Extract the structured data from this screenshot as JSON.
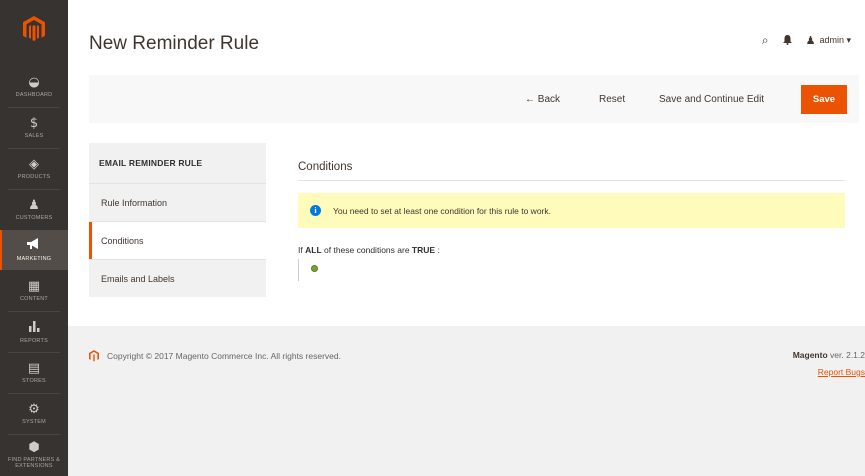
{
  "sidebar": {
    "items": [
      {
        "icon": "◒",
        "label": "Dashboard"
      },
      {
        "icon": "$",
        "label": "Sales"
      },
      {
        "icon": "◈",
        "label": "Products"
      },
      {
        "icon": "♟",
        "label": "Customers"
      },
      {
        "icon": "📣",
        "label": "Marketing"
      },
      {
        "icon": "▦",
        "label": "Content"
      },
      {
        "icon": "▮",
        "label": "Reports"
      },
      {
        "icon": "▤",
        "label": "Stores"
      },
      {
        "icon": "⚙",
        "label": "System"
      },
      {
        "icon": "⬢",
        "label": "Find Partners & Extensions"
      }
    ],
    "active_item": "Marketing"
  },
  "header": {
    "title": "New Reminder Rule",
    "search_icon": "⌕",
    "bell_icon": "♪",
    "user_icon": "♟",
    "user_name": "admin ▾"
  },
  "action_bar": {
    "back": "← Back",
    "reset": "Reset",
    "save_continue": "Save and Continue Edit",
    "save": "Save"
  },
  "tabs": {
    "title": "EMAIL REMINDER RULE",
    "items": [
      "Rule Information",
      "Conditions",
      "Emails and Labels"
    ],
    "active": "Conditions"
  },
  "main": {
    "section_title": "Conditions",
    "notice_icon": "i",
    "notice": "You need to set at least one condition for this rule to work.",
    "cond_prefix": "If",
    "cond_all": "ALL",
    "cond_middle": "of these conditions are",
    "cond_true": "TRUE",
    "cond_suffix": ":"
  },
  "footer": {
    "copyright": "Copyright © 2017 Magento Commerce Inc. All rights reserved.",
    "version_brand": "Magento",
    "version_text": "ver. 2.1.2",
    "report_bugs": "Report Bugs"
  },
  "colors": {
    "sidebar_bg": "#373330",
    "accent": "#eb5202",
    "notice_bg": "#fffbbb",
    "info_blue": "#007bdb",
    "add_green": "#79a22e"
  }
}
